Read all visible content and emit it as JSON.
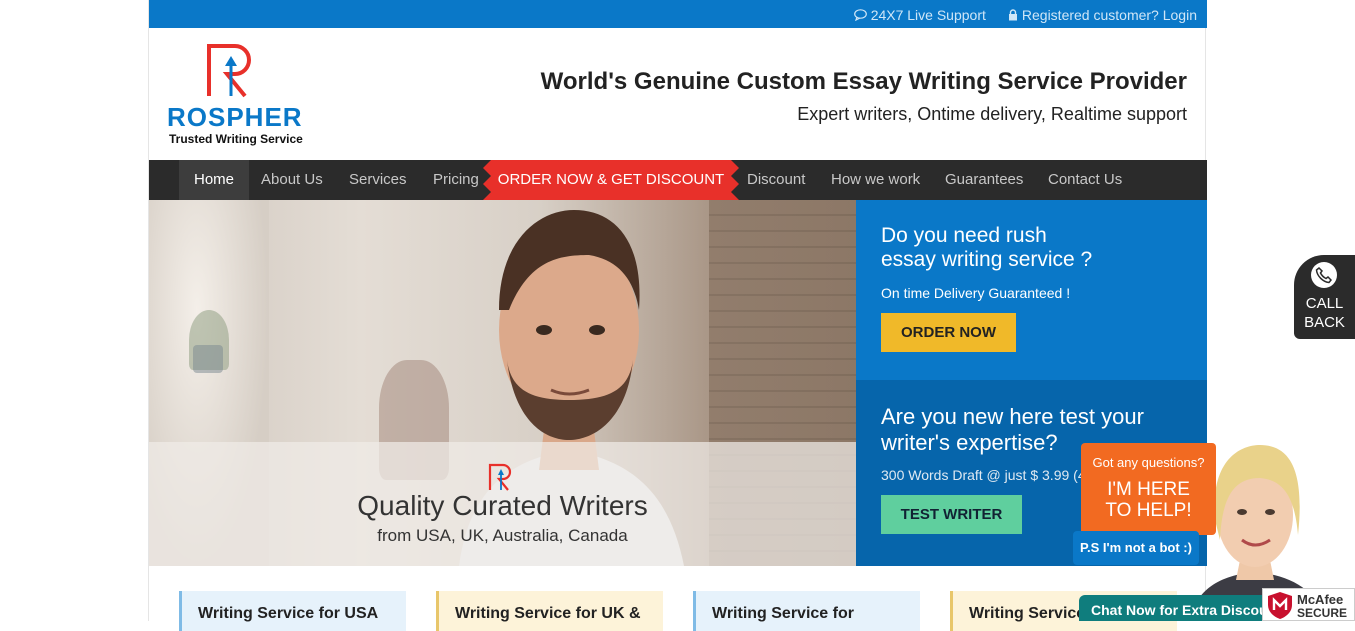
{
  "topbar": {
    "support": "24X7 Live Support",
    "login": "Registered customer? Login"
  },
  "header": {
    "brand": "ROSPHER",
    "tagline": "Trusted Writing Service",
    "headline": "World's Genuine Custom Essay Writing Service Provider",
    "subheadline": "Expert writers, Ontime delivery, Realtime support"
  },
  "nav": {
    "items": [
      "Home",
      "About Us",
      "Services",
      "Pricing"
    ],
    "cta": "ORDER NOW & GET DISCOUNT",
    "items_right": [
      "Discount",
      "How we work",
      "Guarantees",
      "Contact Us"
    ]
  },
  "hero": {
    "title": "Quality Curated Writers",
    "subtitle": "from USA, UK, Australia, Canada"
  },
  "rush": {
    "question_line1": "Do you need rush",
    "question_line2": "essay writing service ?",
    "note": "On time Delivery Guaranteed !",
    "button": "ORDER NOW"
  },
  "test": {
    "question_line1": "Are you new here test your",
    "question_line2": "writer's expertise?",
    "note": "300 Words Draft @ just $ 3.99 (4",
    "button": "TEST WRITER"
  },
  "cards": [
    "Writing Service for USA",
    "Writing Service for UK &",
    "Writing Service for",
    "Writing Service"
  ],
  "callback": {
    "line1": "CALL",
    "line2": "BACK"
  },
  "chat": {
    "question": "Got any questions?",
    "help_line1": "I'M HERE",
    "help_line2": "TO HELP!",
    "bot_note": "P.S I'm not a bot :)",
    "chat_now": "Chat Now for Extra Discount"
  },
  "mcafee": {
    "line1": "McAfee",
    "line2": "SECURE"
  },
  "colors": {
    "brand_blue": "#0a78c8",
    "cta_red": "#e8302a",
    "nav_dark": "#2b2b2b",
    "yellow": "#f0b929",
    "green": "#5fcf9e",
    "orange": "#f26a21"
  }
}
